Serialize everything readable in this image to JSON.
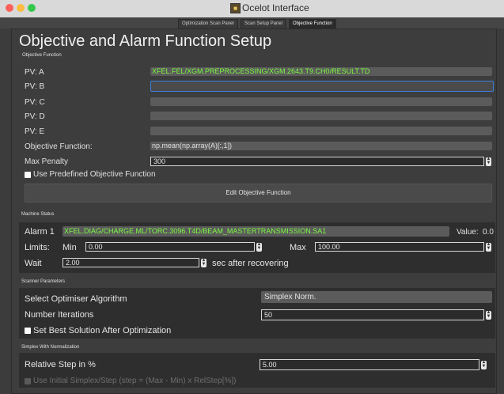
{
  "window": {
    "title": "Ocelot Interface"
  },
  "tabs": [
    {
      "label": "Optimization Scan Panel"
    },
    {
      "label": "Scan Setup Panel"
    },
    {
      "label": "Objective Function"
    }
  ],
  "page": {
    "title": "Objective and Alarm Function Setup"
  },
  "objective": {
    "section_label": "Objective Function",
    "pvs": [
      {
        "label": "PV: A",
        "value": "XFEL.FEL/XGM.PREPROCESSING/XGM.2643.T9.CH0/RESULT.TD"
      },
      {
        "label": "PV: B",
        "value": ""
      },
      {
        "label": "PV: C",
        "value": ""
      },
      {
        "label": "PV: D",
        "value": ""
      },
      {
        "label": "PV: E",
        "value": ""
      }
    ],
    "function_label": "Objective Function:",
    "function_value": "np.mean(np.array(A)[:,1])",
    "max_penalty_label": "Max Penalty",
    "max_penalty_value": "300",
    "predefined_label": "Use Predefined Objective Function",
    "edit_button": "Edit Objective Function"
  },
  "machine": {
    "section_label": "Machine Status",
    "alarm_label": "Alarm 1",
    "alarm_pv": "XFEL.DIAG/CHARGE.ML/TORC.3096.T4D/BEAM_MASTERTRANSMISSION.SA1",
    "value_label": "Value:",
    "value": "0.0",
    "limits_label": "Limits:",
    "min_label": "Min",
    "min_value": "0.00",
    "max_label": "Max",
    "max_value": "100.00",
    "wait_label": "Wait",
    "wait_value": "2.00",
    "wait_suffix": "sec after recovering"
  },
  "scanner": {
    "section_label": "Scanner Parameters",
    "algorithm_label": "Select Optimiser Algorithm",
    "algorithm_value": "Simplex Norm.",
    "iterations_label": "Number Iterations",
    "iterations_value": "50",
    "best_solution_label": "Set Best Solution After Optimization"
  },
  "simplex": {
    "section_label": "Simplex With Normalization",
    "step_label": "Relative Step in %",
    "step_value": "5.00",
    "initial_label": "Use Initial Simplex/Step (step = (Max - Min) x RelStep[%])"
  },
  "colors": {
    "accent_green": "#7cfc3f",
    "focus_blue": "#3b7fd9",
    "background": "#3c3c3c"
  }
}
